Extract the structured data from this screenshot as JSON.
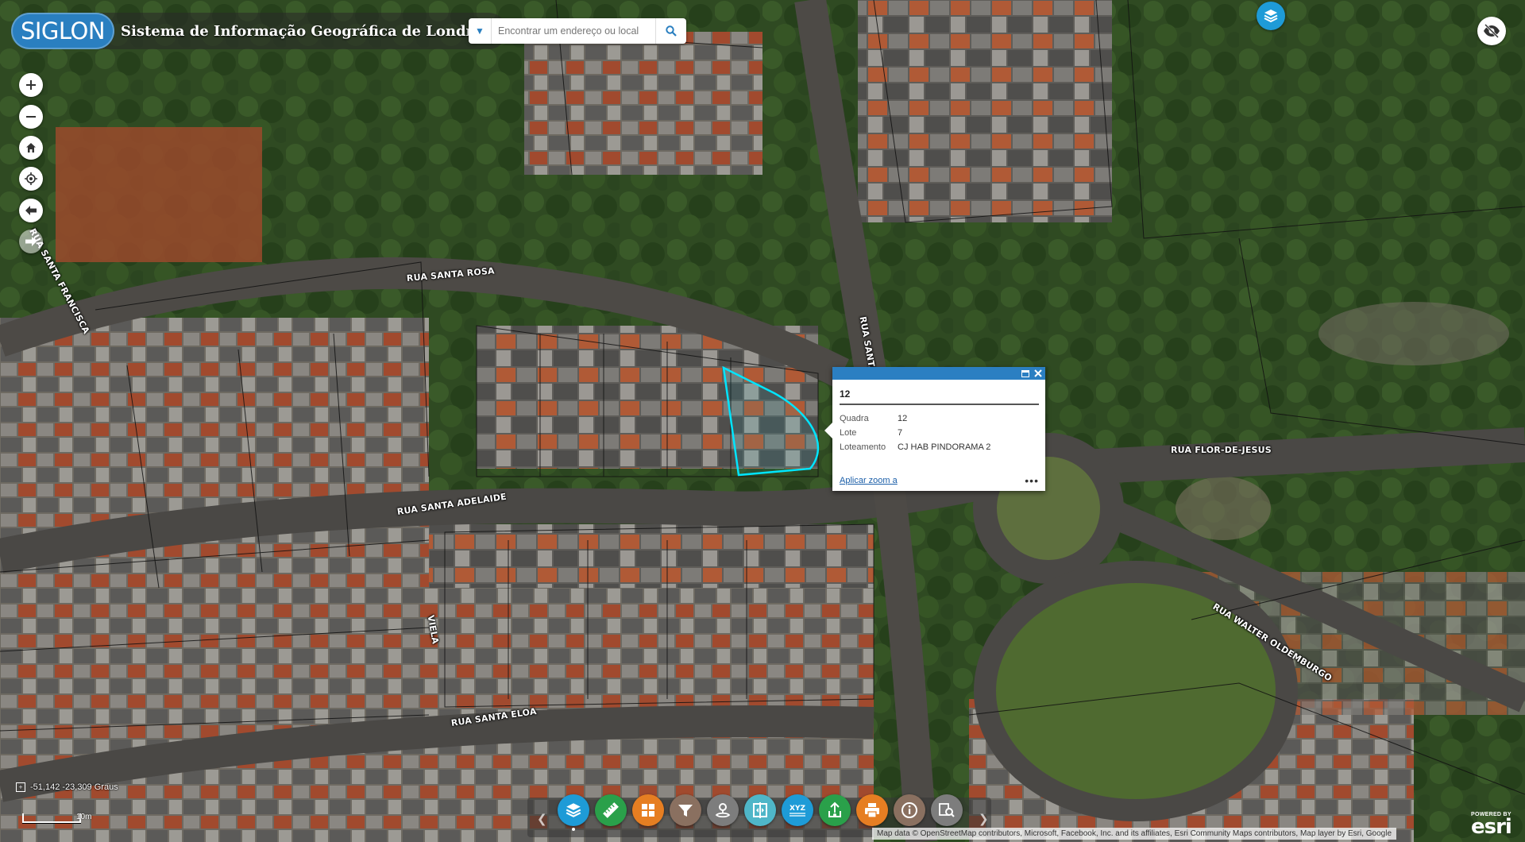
{
  "app": {
    "logo_text": "SIGLON",
    "title": "Sistema de Informação Geográfica de Londrina"
  },
  "search": {
    "placeholder": "Encontrar um endereço ou local",
    "dropdown_icon": "chevron-down-icon",
    "button_icon": "search-icon"
  },
  "map_controls": [
    {
      "name": "zoom-in",
      "icon": "plus-icon"
    },
    {
      "name": "zoom-out",
      "icon": "minus-icon"
    },
    {
      "name": "home",
      "icon": "home-icon"
    },
    {
      "name": "locate",
      "icon": "locate-icon"
    },
    {
      "name": "previous-extent",
      "icon": "arrow-left-icon"
    },
    {
      "name": "next-extent",
      "icon": "arrow-right-icon",
      "disabled": true
    }
  ],
  "street_labels": {
    "rua_santa_rosa": "RUA SANTA ROSA",
    "rua_santa_francisca": "RUA SANTA FRANCISCA",
    "rua_santa_te": "RUA SANTA TE",
    "rua_santa_adelaide": "RUA SANTA ADELAIDE",
    "rua_flor_de_jesus": "RUA FLOR-DE-JESUS",
    "viela": "VIELA",
    "rua_walter_oldemburgo": "RUA WALTER OLDEMBURGO",
    "rua_santa_eloa": "RUA SANTA ELOA"
  },
  "popup": {
    "title": "12",
    "fields": [
      {
        "key": "Quadra",
        "value": "12"
      },
      {
        "key": "Lote",
        "value": "7"
      },
      {
        "key": "Loteamento",
        "value": "CJ HAB PINDORAMA 2"
      }
    ],
    "zoom_link": "Aplicar zoom a",
    "more": "•••"
  },
  "status": {
    "coordinates": "-51,142 -23,309 Graus",
    "scale_label": "10m"
  },
  "toolbar": [
    {
      "name": "layers",
      "icon": "layers-icon",
      "color": "#1e9bd7",
      "active": true
    },
    {
      "name": "measure",
      "icon": "ruler-icon",
      "color": "#2aa04a"
    },
    {
      "name": "basemap",
      "icon": "grid-icon",
      "color": "#e67e22"
    },
    {
      "name": "filter",
      "icon": "filter-icon",
      "color": "#8a7060"
    },
    {
      "name": "directions",
      "icon": "route-icon",
      "color": "#7d7d7d"
    },
    {
      "name": "swipe",
      "icon": "swipe-icon",
      "color": "#4fb6c8"
    },
    {
      "name": "coordinates",
      "icon": "xyz-icon",
      "color": "#1e9bd7",
      "label": "XYZ"
    },
    {
      "name": "share",
      "icon": "share-icon",
      "color": "#2aa04a"
    },
    {
      "name": "print",
      "icon": "print-icon",
      "color": "#e67e22"
    },
    {
      "name": "about",
      "icon": "info-icon",
      "color": "#8a7060"
    },
    {
      "name": "query",
      "icon": "query-icon",
      "color": "#7d7d7d"
    }
  ],
  "attribution": "Map data © OpenStreetMap contributors, Microsoft, Facebook, Inc. and its affiliates, Esri Community Maps contributors, Map layer by Esri, Google",
  "esri": {
    "powered_by": "POWERED BY",
    "brand": "esri"
  },
  "colors": {
    "accent": "#2b7fc2",
    "selection": "#00e5ff"
  }
}
